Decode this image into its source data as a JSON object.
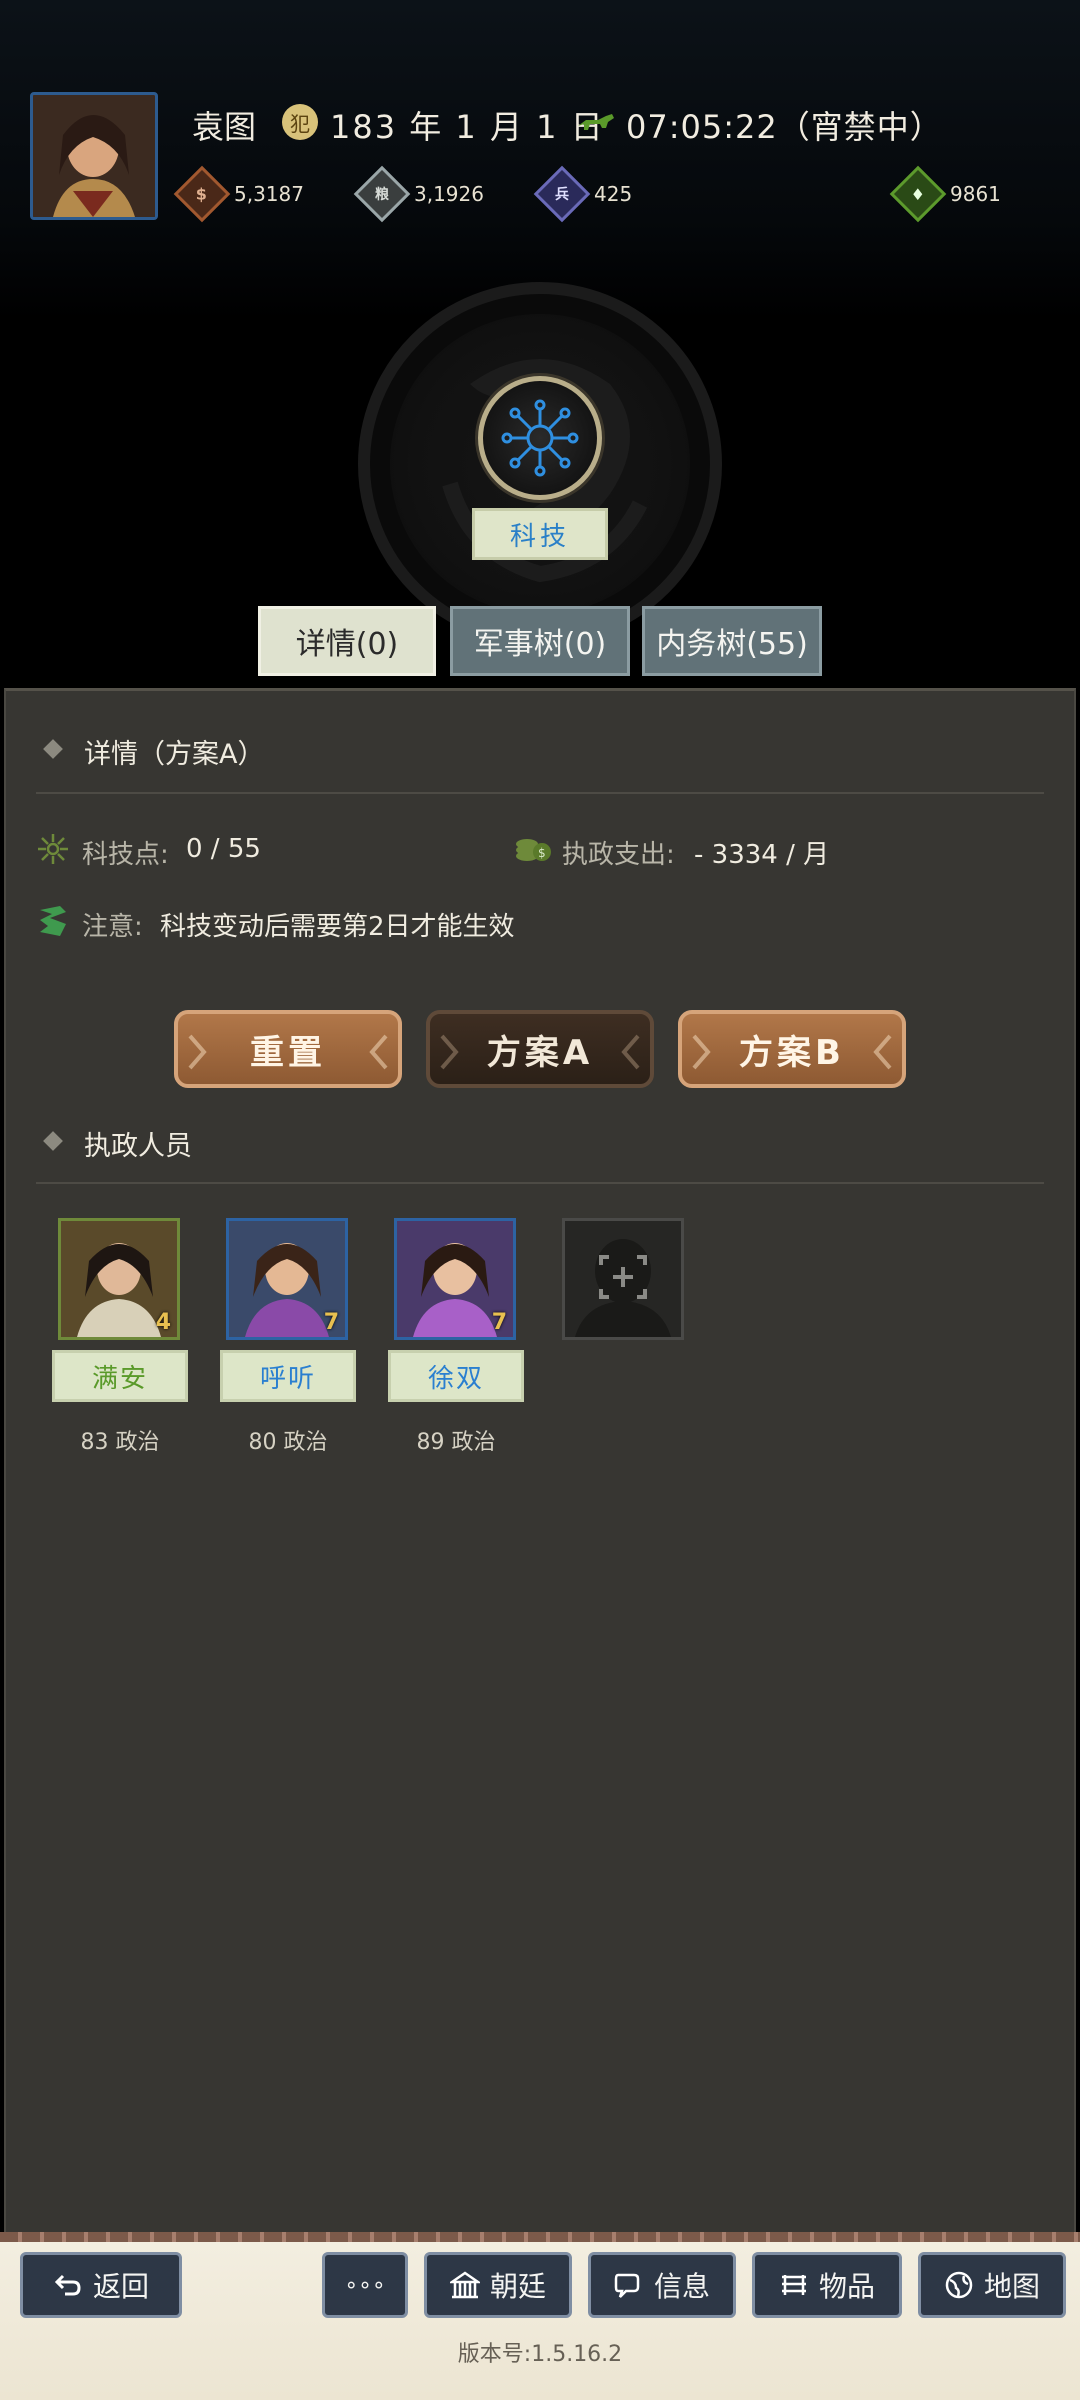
{
  "header": {
    "player_name": "袁图",
    "seal_glyph": "犯",
    "date": "183 年 1 月 1 日",
    "time": "07:05:22（宵禁中）",
    "resources": [
      {
        "name": "gold",
        "icon_glyph": "$",
        "value": "5,3187",
        "color": "#a1582f"
      },
      {
        "name": "food",
        "icon_glyph": "粮",
        "value": "3,1926",
        "color": "#9aa6a8"
      },
      {
        "name": "troops",
        "icon_glyph": "兵",
        "value": "425",
        "color": "#5a5aa8"
      },
      {
        "name": "morale",
        "icon_glyph": "♦",
        "value": "9861",
        "color": "#5c9a2c"
      }
    ]
  },
  "emblem": {
    "title": "科技"
  },
  "tabs": [
    {
      "label": "详情(0)",
      "active": true
    },
    {
      "label": "军事树(0)",
      "active": false
    },
    {
      "label": "内务树(55)",
      "active": false
    }
  ],
  "details": {
    "section_title": "详情（方案A）",
    "tech_points_label": "科技点:",
    "tech_points_value": "0 / 55",
    "spending_label": "执政支出:",
    "spending_value": "- 3334 / 月",
    "notice_label": "注意:",
    "notice_text": "科技变动后需要第2日才能生效"
  },
  "plan_buttons": [
    {
      "label": "重置",
      "style": "brown"
    },
    {
      "label": "方案A",
      "style": "dark"
    },
    {
      "label": "方案B",
      "style": "brown"
    }
  ],
  "officers_section": {
    "title": "执政人员",
    "officers": [
      {
        "name": "满安",
        "stat": "83 政治",
        "cost": "4",
        "name_color": "#5a9a2a",
        "border": "#6f8a3a"
      },
      {
        "name": "呼听",
        "stat": "80 政治",
        "cost": "7",
        "name_color": "#2a7fd0",
        "border": "#2d63a3"
      },
      {
        "name": "徐双",
        "stat": "89 政治",
        "cost": "7",
        "name_color": "#2a7fd0",
        "border": "#2d63a3"
      }
    ]
  },
  "footer": {
    "back_label": "返回",
    "more_label": "∘∘∘",
    "court_label": "朝廷",
    "info_label": "信息",
    "items_label": "物品",
    "map_label": "地图",
    "version": "版本号:1.5.16.2"
  }
}
